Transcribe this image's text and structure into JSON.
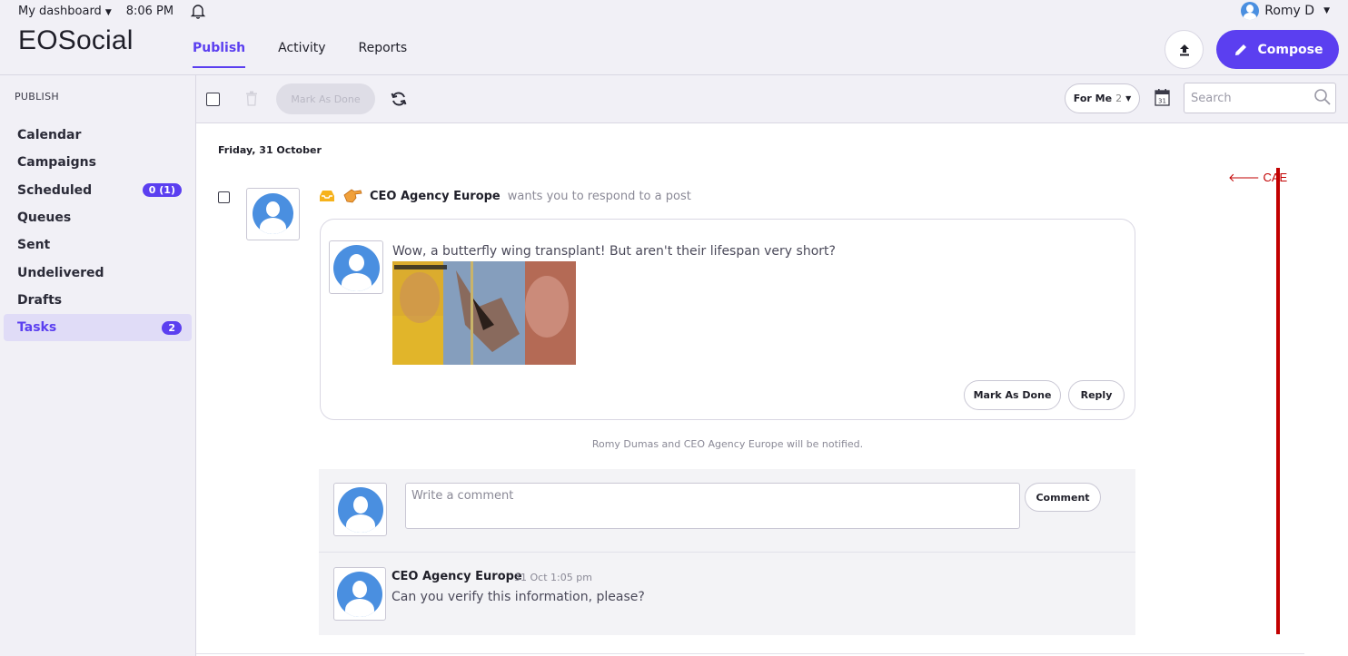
{
  "topbar": {
    "dashboard_label": "My dashboard",
    "time": "8:06 PM"
  },
  "brand": "EOSocial",
  "nav": {
    "tabs": [
      {
        "label": "Publish",
        "active": true
      },
      {
        "label": "Activity"
      },
      {
        "label": "Reports"
      }
    ]
  },
  "user": {
    "name": "Romy D"
  },
  "header_actions": {
    "compose_label": "Compose"
  },
  "sidebar": {
    "heading": "PUBLISH",
    "items": [
      {
        "label": "Calendar"
      },
      {
        "label": "Campaigns"
      },
      {
        "label": "Scheduled",
        "badge": "0 (1)"
      },
      {
        "label": "Queues"
      },
      {
        "label": "Sent"
      },
      {
        "label": "Undelivered"
      },
      {
        "label": "Drafts"
      },
      {
        "label": "Tasks",
        "badge": "2",
        "active": true
      }
    ]
  },
  "toolbar": {
    "mark_done_label": "Mark As Done",
    "filter_label": "For Me",
    "filter_count": "2",
    "search_placeholder": "Search"
  },
  "feed": {
    "date_heading": "Friday, 31 October",
    "profile_tag": "CAE",
    "task": {
      "author": "CEO Agency Europe",
      "action_text": "wants you to respond to a post",
      "post_text": "Wow, a butterfly wing transplant! But aren't their lifespan very short?",
      "mark_done_label": "Mark As Done",
      "reply_label": "Reply",
      "notify_text": "Romy Dumas and CEO Agency Europe will be notified."
    },
    "comment_box": {
      "placeholder": "Write a comment",
      "button_label": "Comment"
    },
    "comments": [
      {
        "author": "CEO Agency Europe",
        "time": "31 Oct 1:05 pm",
        "text": "Can you verify this information, please?"
      }
    ]
  },
  "colors": {
    "accent": "#5b3ff0",
    "profile_line": "#c20000",
    "avatar": "#4a8fe0"
  }
}
